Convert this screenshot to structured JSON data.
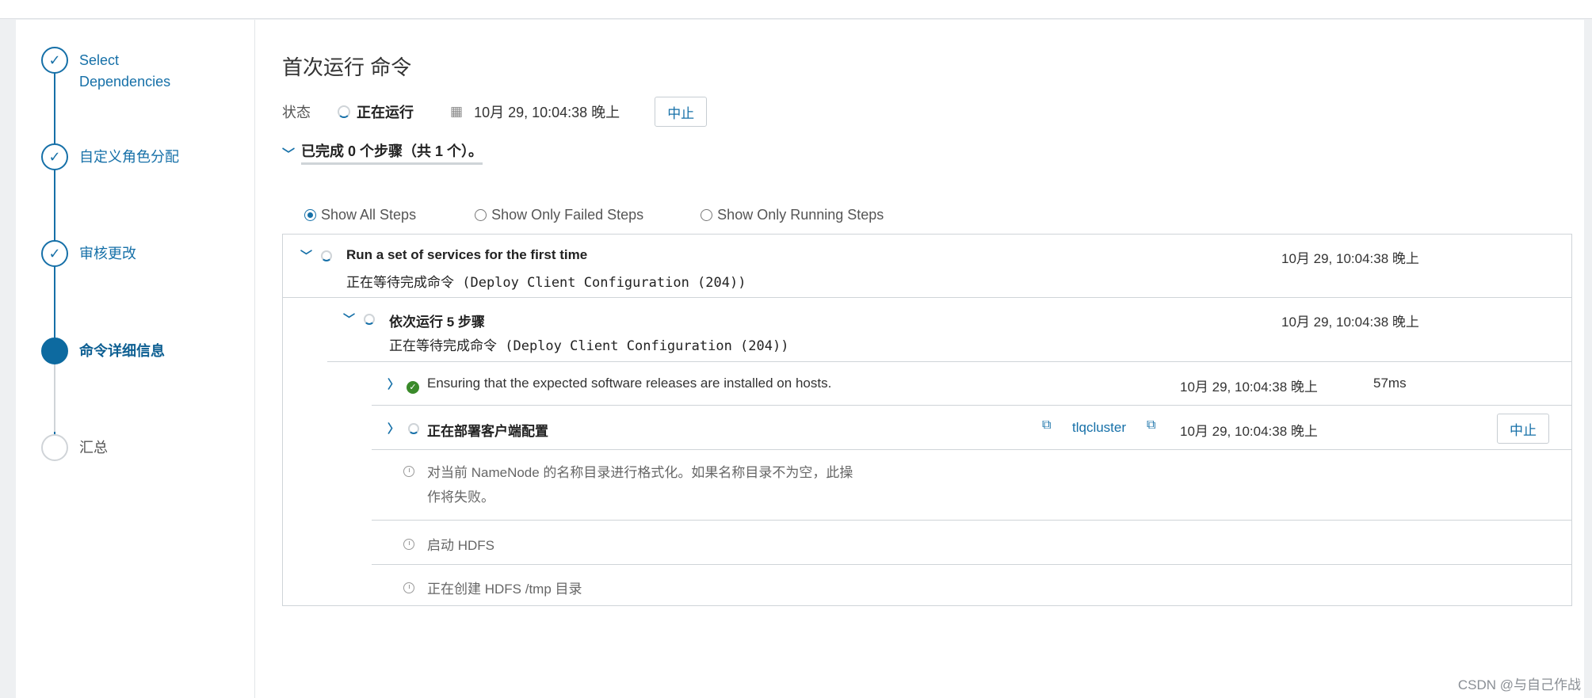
{
  "wizard": {
    "steps": [
      {
        "label": "Select Dependencies",
        "state": "done"
      },
      {
        "label": "自定义角色分配",
        "state": "done"
      },
      {
        "label": "审核更改",
        "state": "done"
      },
      {
        "label": "命令详细信息",
        "state": "active"
      },
      {
        "label": "汇总",
        "state": "todo"
      }
    ]
  },
  "command": {
    "title": "首次运行 命令",
    "status_label": "状态",
    "status_value": "正在运行",
    "start_time": "10月 29, 10:04:38 晚上",
    "abort_label": "中止",
    "summary": "已完成 0 个步骤（共 1 个）。"
  },
  "filters": {
    "options": [
      "Show All Steps",
      "Show Only Failed Steps",
      "Show Only Running Steps"
    ],
    "selected": "Show All Steps"
  },
  "steps": {
    "root": {
      "title": "Run a set of services for the first time",
      "detail": "正在等待完成命令 (Deploy Client Configuration (204))",
      "time": "10月 29, 10:04:38 晚上"
    },
    "sequence": {
      "title": "依次运行 5 步骤",
      "detail": "正在等待完成命令 (Deploy Client Configuration (204))",
      "time": "10月 29, 10:04:38 晚上"
    },
    "items": [
      {
        "title": "Ensuring that the expected software releases are installed on hosts.",
        "time": "10月 29, 10:04:38 晚上",
        "duration": "57ms",
        "state": "done"
      },
      {
        "title": "正在部署客户端配置",
        "cluster": "tlqcluster",
        "time": "10月 29, 10:04:38 晚上",
        "abort_label": "中止",
        "state": "running"
      },
      {
        "title_line1": "对当前 NameNode 的名称目录进行格式化。如果名称目录不为空，此操",
        "title_line2": "作将失败。",
        "state": "pending"
      },
      {
        "title": "启动 HDFS",
        "state": "pending"
      },
      {
        "title": "正在创建 HDFS /tmp 目录",
        "state": "pending"
      }
    ]
  },
  "watermark": "CSDN @与自己作战",
  "colors": {
    "accent": "#1670a8",
    "success": "#3a8a2a",
    "border": "#cfd4d8"
  }
}
